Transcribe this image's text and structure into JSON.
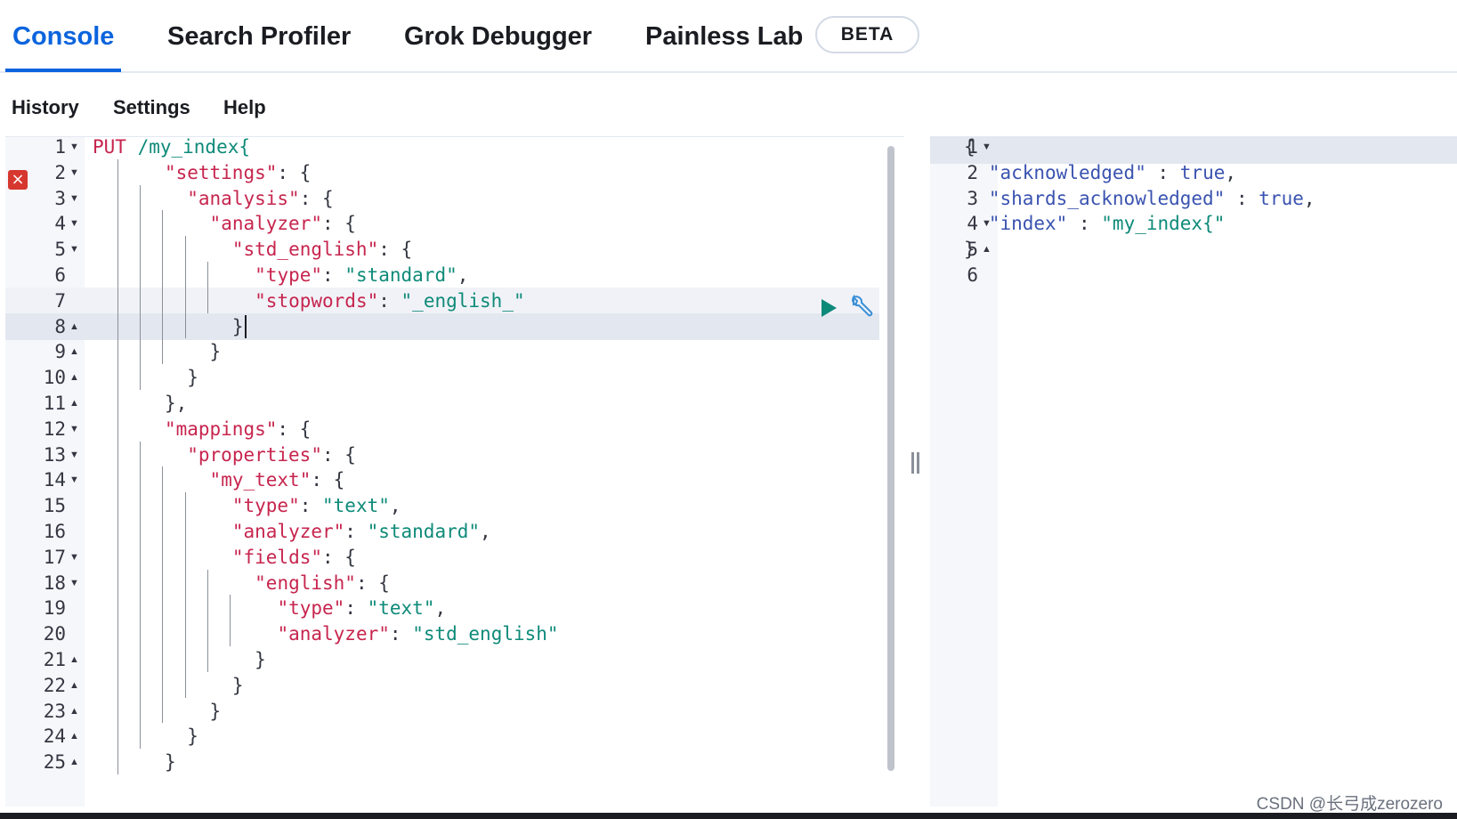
{
  "tabs": {
    "console": "Console",
    "search_profiler": "Search Profiler",
    "grok_debugger": "Grok Debugger",
    "painless_lab": "Painless Lab",
    "beta_badge": "BETA",
    "active": "Console"
  },
  "menu": {
    "history": "History",
    "settings": "Settings",
    "help": "Help"
  },
  "colors": {
    "accent": "#0b64dd",
    "key": "#c7254e",
    "string": "#0e8a79",
    "boolean": "#3a53b0",
    "error": "#d6372e"
  },
  "icons": {
    "error": "error-x-icon",
    "run": "play-icon",
    "request_options": "wrench-icon",
    "fold_open": "fold-down-icon",
    "fold_close": "fold-up-icon"
  },
  "request_editor": {
    "error_line": 2,
    "active_line": 8,
    "lines": [
      {
        "n": "1",
        "fold": "▾",
        "depth": 0,
        "tokens": [
          {
            "t": "PUT ",
            "c": "t-method"
          },
          {
            "t": "/my_index{",
            "c": "t-url"
          }
        ]
      },
      {
        "n": "2",
        "fold": "▾",
        "depth": 1,
        "tokens": [
          {
            "t": "\"settings\"",
            "c": "t-key"
          },
          {
            "t": ": {",
            "c": "t-punc"
          }
        ]
      },
      {
        "n": "3",
        "fold": "▾",
        "depth": 2,
        "tokens": [
          {
            "t": "\"analysis\"",
            "c": "t-key"
          },
          {
            "t": ": {",
            "c": "t-punc"
          }
        ]
      },
      {
        "n": "4",
        "fold": "▾",
        "depth": 3,
        "tokens": [
          {
            "t": "\"analyzer\"",
            "c": "t-key"
          },
          {
            "t": ": {",
            "c": "t-punc"
          }
        ]
      },
      {
        "n": "5",
        "fold": "▾",
        "depth": 4,
        "tokens": [
          {
            "t": "\"std_english\"",
            "c": "t-key"
          },
          {
            "t": ": {",
            "c": "t-punc"
          }
        ]
      },
      {
        "n": "6",
        "fold": "",
        "depth": 5,
        "tokens": [
          {
            "t": "\"type\"",
            "c": "t-key"
          },
          {
            "t": ": ",
            "c": "t-punc"
          },
          {
            "t": "\"standard\"",
            "c": "t-str"
          },
          {
            "t": ",",
            "c": "t-punc"
          }
        ]
      },
      {
        "n": "7",
        "fold": "",
        "depth": 5,
        "tokens": [
          {
            "t": "\"stopwords\"",
            "c": "t-key"
          },
          {
            "t": ": ",
            "c": "t-punc"
          },
          {
            "t": "\"_english_\"",
            "c": "t-str"
          }
        ]
      },
      {
        "n": "8",
        "fold": "▴",
        "depth": 4,
        "tokens": [
          {
            "t": "}",
            "c": "t-punc"
          }
        ]
      },
      {
        "n": "9",
        "fold": "▴",
        "depth": 3,
        "tokens": [
          {
            "t": "}",
            "c": "t-punc"
          }
        ]
      },
      {
        "n": "10",
        "fold": "▴",
        "depth": 2,
        "tokens": [
          {
            "t": "}",
            "c": "t-punc"
          }
        ]
      },
      {
        "n": "11",
        "fold": "▴",
        "depth": 1,
        "tokens": [
          {
            "t": "},",
            "c": "t-punc"
          }
        ]
      },
      {
        "n": "12",
        "fold": "▾",
        "depth": 1,
        "tokens": [
          {
            "t": "\"mappings\"",
            "c": "t-key"
          },
          {
            "t": ": {",
            "c": "t-punc"
          }
        ]
      },
      {
        "n": "13",
        "fold": "▾",
        "depth": 2,
        "tokens": [
          {
            "t": "\"properties\"",
            "c": "t-key"
          },
          {
            "t": ": {",
            "c": "t-punc"
          }
        ]
      },
      {
        "n": "14",
        "fold": "▾",
        "depth": 3,
        "tokens": [
          {
            "t": "\"my_text\"",
            "c": "t-key"
          },
          {
            "t": ": {",
            "c": "t-punc"
          }
        ]
      },
      {
        "n": "15",
        "fold": "",
        "depth": 4,
        "tokens": [
          {
            "t": "\"type\"",
            "c": "t-key"
          },
          {
            "t": ": ",
            "c": "t-punc"
          },
          {
            "t": "\"text\"",
            "c": "t-str"
          },
          {
            "t": ",",
            "c": "t-punc"
          }
        ]
      },
      {
        "n": "16",
        "fold": "",
        "depth": 4,
        "tokens": [
          {
            "t": "\"analyzer\"",
            "c": "t-key"
          },
          {
            "t": ": ",
            "c": "t-punc"
          },
          {
            "t": "\"standard\"",
            "c": "t-str"
          },
          {
            "t": ",",
            "c": "t-punc"
          }
        ]
      },
      {
        "n": "17",
        "fold": "▾",
        "depth": 4,
        "tokens": [
          {
            "t": "\"fields\"",
            "c": "t-key"
          },
          {
            "t": ": {",
            "c": "t-punc"
          }
        ]
      },
      {
        "n": "18",
        "fold": "▾",
        "depth": 5,
        "tokens": [
          {
            "t": "\"english\"",
            "c": "t-key"
          },
          {
            "t": ": {",
            "c": "t-punc"
          }
        ]
      },
      {
        "n": "19",
        "fold": "",
        "depth": 6,
        "tokens": [
          {
            "t": "\"type\"",
            "c": "t-key"
          },
          {
            "t": ": ",
            "c": "t-punc"
          },
          {
            "t": "\"text\"",
            "c": "t-str"
          },
          {
            "t": ",",
            "c": "t-punc"
          }
        ]
      },
      {
        "n": "20",
        "fold": "",
        "depth": 6,
        "tokens": [
          {
            "t": "\"analyzer\"",
            "c": "t-key"
          },
          {
            "t": ": ",
            "c": "t-punc"
          },
          {
            "t": "\"std_english\"",
            "c": "t-str"
          }
        ]
      },
      {
        "n": "21",
        "fold": "▴",
        "depth": 5,
        "tokens": [
          {
            "t": "}",
            "c": "t-punc"
          }
        ]
      },
      {
        "n": "22",
        "fold": "▴",
        "depth": 4,
        "tokens": [
          {
            "t": "}",
            "c": "t-punc"
          }
        ]
      },
      {
        "n": "23",
        "fold": "▴",
        "depth": 3,
        "tokens": [
          {
            "t": "}",
            "c": "t-punc"
          }
        ]
      },
      {
        "n": "24",
        "fold": "▴",
        "depth": 2,
        "tokens": [
          {
            "t": "}",
            "c": "t-punc"
          }
        ]
      },
      {
        "n": "25",
        "fold": "▴",
        "depth": 1,
        "tokens": [
          {
            "t": "}",
            "c": "t-punc"
          }
        ]
      }
    ]
  },
  "response_output": {
    "lines": [
      {
        "n": "1",
        "fold": "▾",
        "indent": 0,
        "tokens": [
          {
            "t": "{",
            "c": "t-punc"
          }
        ]
      },
      {
        "n": "2",
        "fold": "",
        "indent": 1,
        "tokens": [
          {
            "t": "\"acknowledged\"",
            "c": "t-bool"
          },
          {
            "t": " : ",
            "c": "t-punc"
          },
          {
            "t": "true",
            "c": "t-bool"
          },
          {
            "t": ",",
            "c": "t-punc"
          }
        ]
      },
      {
        "n": "3",
        "fold": "",
        "indent": 1,
        "tokens": [
          {
            "t": "\"shards_acknowledged\"",
            "c": "t-bool"
          },
          {
            "t": " : ",
            "c": "t-punc"
          },
          {
            "t": "true",
            "c": "t-bool"
          },
          {
            "t": ",",
            "c": "t-punc"
          }
        ]
      },
      {
        "n": "4",
        "fold": "▾",
        "indent": 1,
        "tokens": [
          {
            "t": "\"index\"",
            "c": "t-bool"
          },
          {
            "t": " : ",
            "c": "t-punc"
          },
          {
            "t": "\"my_index{\"",
            "c": "t-str"
          }
        ]
      },
      {
        "n": "5",
        "fold": "▴",
        "indent": 0,
        "tokens": [
          {
            "t": "}",
            "c": "t-punc"
          }
        ]
      },
      {
        "n": "6",
        "fold": "",
        "indent": 0,
        "tokens": []
      }
    ]
  },
  "watermark": "CSDN @长弓成zerozero"
}
